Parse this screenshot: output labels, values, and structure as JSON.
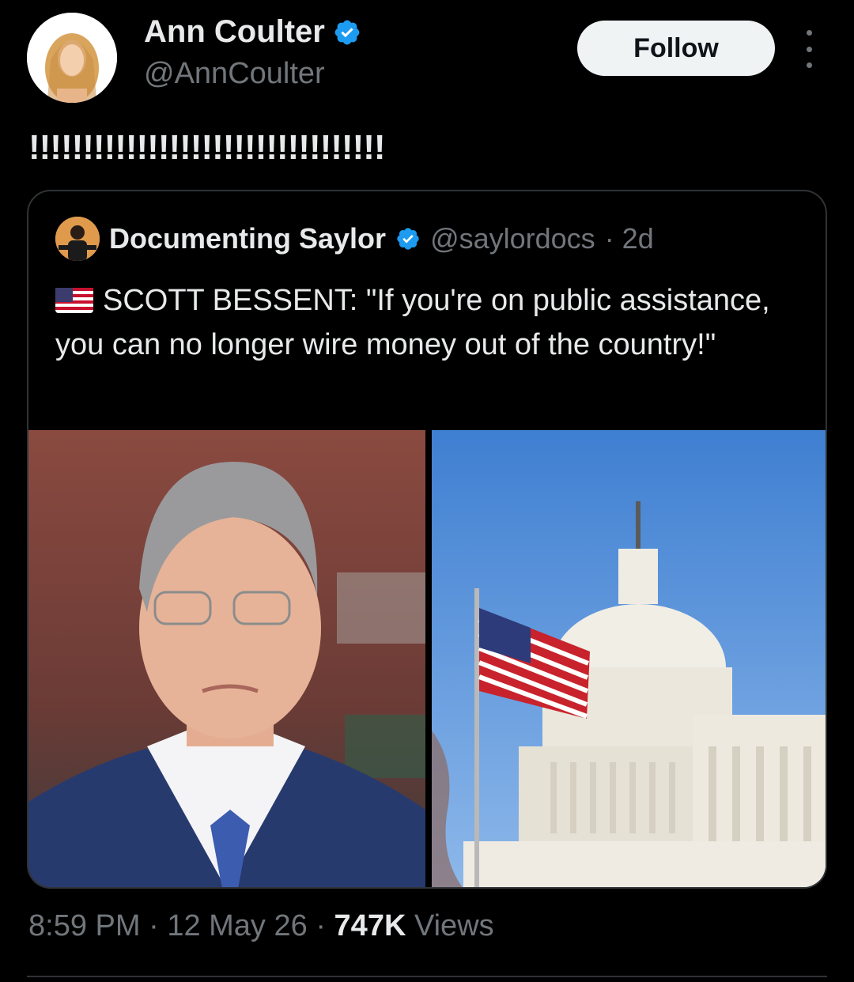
{
  "author": {
    "name": "Ann Coulter",
    "handle": "@AnnCoulter",
    "verified_icon": "verified-badge-icon"
  },
  "follow_label": "Follow",
  "tweet_text": "!!!!!!!!!!!!!!!!!!!!!!!!!!!!!!!!!",
  "quoted": {
    "name": "Documenting Saylor",
    "handle": "@saylordocs",
    "time": "· 2d",
    "flag_icon": "us-flag-icon",
    "text": "SCOTT BESSENT: \"If you're on public assistance, you can no longer wire money out of the country!\""
  },
  "meta": {
    "time": "8:59 PM",
    "sep1": "·",
    "date": "12 May 26",
    "sep2": "·",
    "views_count": "747K",
    "views_label": "Views"
  },
  "colors": {
    "background": "#000000",
    "text": "#e7e9ea",
    "secondary": "#71767b",
    "verified": "#1d9bf0",
    "border": "#2f3336"
  }
}
